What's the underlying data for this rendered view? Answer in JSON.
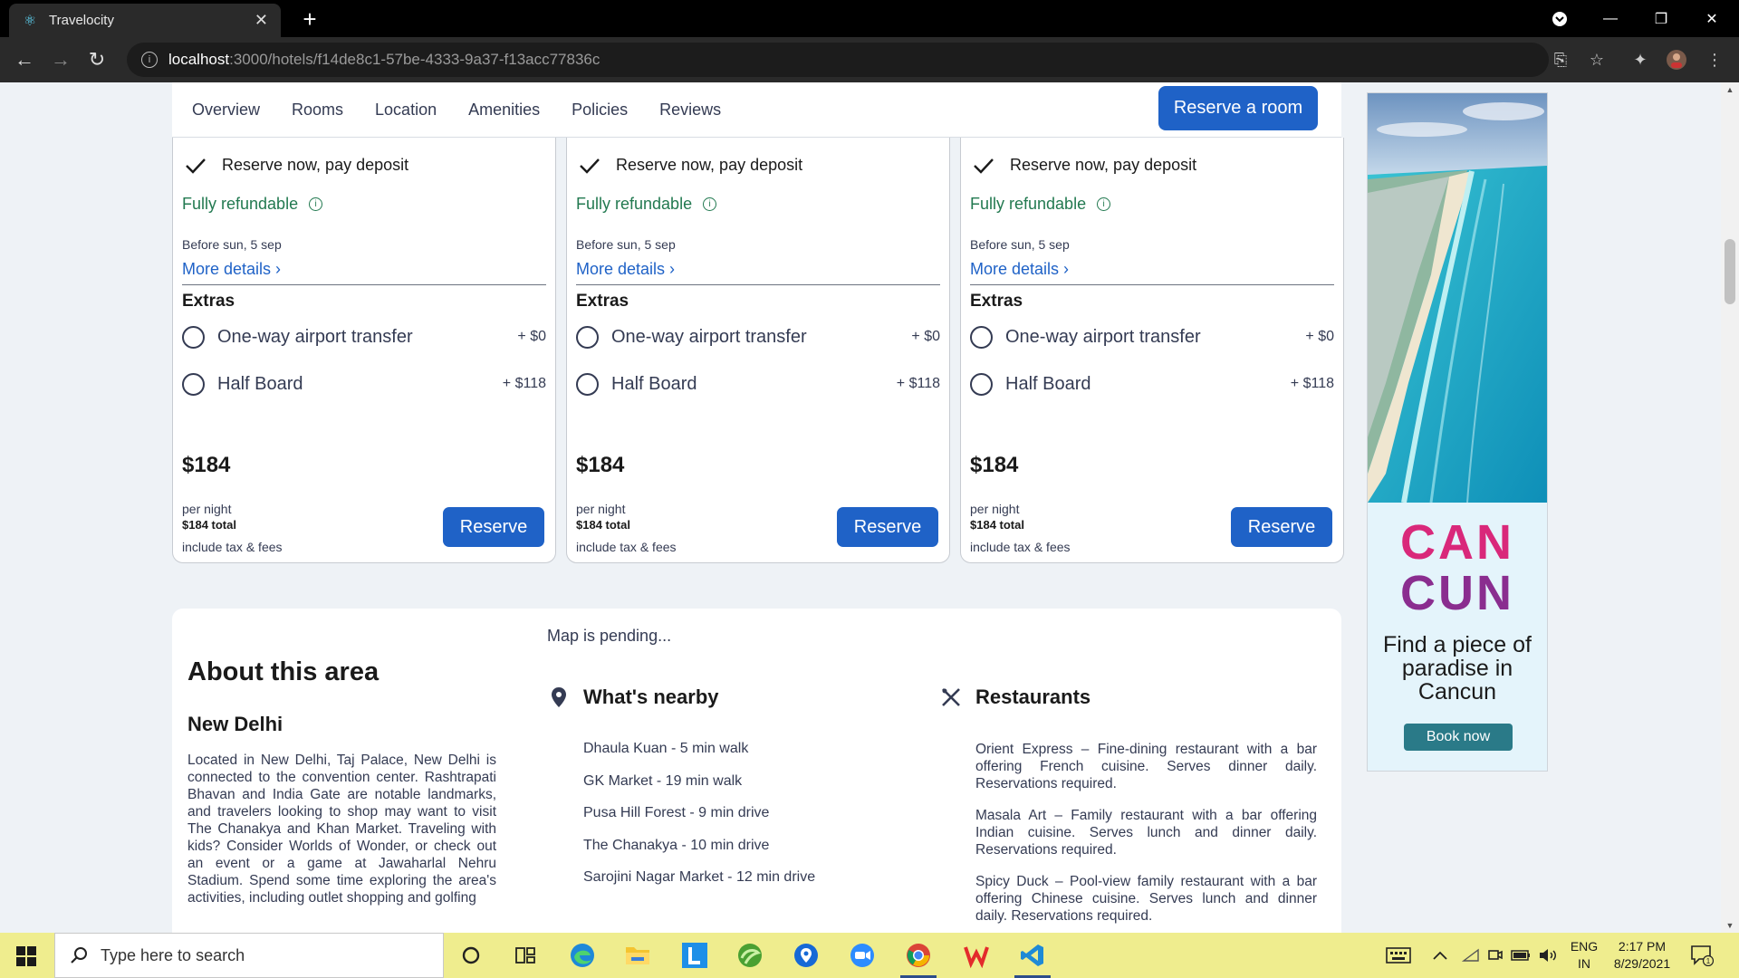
{
  "browser": {
    "tab_title": "Travelocity",
    "url_host": "localhost",
    "url_path": ":3000/hotels/f14de8c1-57be-4333-9a37-f13acc77836c"
  },
  "subnav": {
    "links": [
      "Overview",
      "Rooms",
      "Location",
      "Amenities",
      "Policies",
      "Reviews"
    ],
    "reserve_room": "Reserve a room"
  },
  "cards": [
    {
      "deposit": "Reserve now, pay deposit",
      "refundable": "Fully refundable",
      "before": "Before sun, 5 sep",
      "more_details": "More details",
      "extras_title": "Extras",
      "options": [
        {
          "label": "One-way airport transfer",
          "price": "+ $0"
        },
        {
          "label": "Half Board",
          "price": "+ $118"
        }
      ],
      "price": "$184",
      "per_night": "per night",
      "total": "$184 total",
      "include": "include tax & fees",
      "reserve": "Reserve"
    },
    {
      "deposit": "Reserve now, pay deposit",
      "refundable": "Fully refundable",
      "before": "Before sun, 5 sep",
      "more_details": "More details",
      "extras_title": "Extras",
      "options": [
        {
          "label": "One-way airport transfer",
          "price": "+ $0"
        },
        {
          "label": "Half Board",
          "price": "+ $118"
        }
      ],
      "price": "$184",
      "per_night": "per night",
      "total": "$184 total",
      "include": "include tax & fees",
      "reserve": "Reserve"
    },
    {
      "deposit": "Reserve now, pay deposit",
      "refundable": "Fully refundable",
      "before": "Before sun, 5 sep",
      "more_details": "More details",
      "extras_title": "Extras",
      "options": [
        {
          "label": "One-way airport transfer",
          "price": "+ $0"
        },
        {
          "label": "Half Board",
          "price": "+ $118"
        }
      ],
      "price": "$184",
      "per_night": "per night",
      "total": "$184 total",
      "include": "include tax & fees",
      "reserve": "Reserve"
    }
  ],
  "area": {
    "title": "About this area",
    "city": "New Delhi",
    "description": "Located in New Delhi, Taj Palace, New Delhi is connected to the convention center. Rashtrapati Bhavan and India Gate are notable landmarks, and travelers looking to shop may want to visit The Chanakya and Khan Market. Traveling with kids? Consider Worlds of Wonder, or check out an event or a game at Jawaharlal Nehru Stadium. Spend some time exploring the area's activities, including outlet shopping and golfing",
    "map_status": "Map is pending...",
    "nearby_title": "What's nearby",
    "nearby": [
      "Dhaula Kuan - 5 min walk",
      "GK Market - 19 min walk",
      "Pusa Hill Forest - 9 min drive",
      "The Chanakya - 10 min drive",
      "Sarojini Nagar Market - 12 min drive"
    ],
    "restaurants_title": "Restaurants",
    "restaurants": [
      "Orient Express – Fine-dining restaurant with a bar offering French cuisine. Serves dinner daily. Reservations required.",
      "Masala Art – Family restaurant with a bar offering Indian cuisine. Serves lunch and dinner daily. Reservations required.",
      "Spicy Duck – Pool-view family restaurant with a bar offering Chinese cuisine. Serves lunch and dinner daily. Reservations required."
    ]
  },
  "ad": {
    "line1": "CAN",
    "line2": "CUN",
    "tagline": "Find a piece of paradise in Cancun",
    "cta": "Book now"
  },
  "taskbar": {
    "search_placeholder": "Type here to search",
    "lang_top": "ENG",
    "lang_bottom": "IN",
    "time": "2:17 PM",
    "date": "8/29/2021",
    "notification_count": "1"
  },
  "colors": {
    "primary_blue": "#1f62c7",
    "refund_green": "#227950",
    "taskbar": "#efed8e"
  }
}
